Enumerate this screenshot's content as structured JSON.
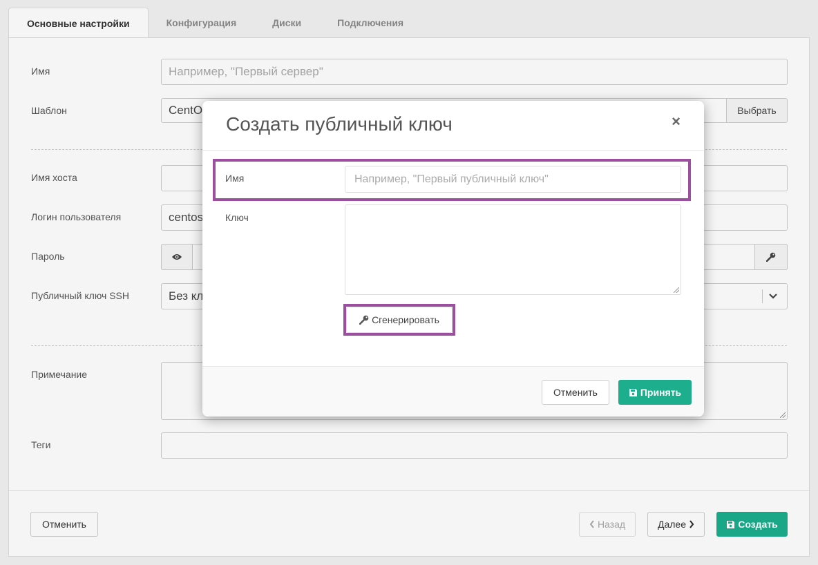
{
  "tabs": [
    {
      "label": "Основные настройки",
      "active": true
    },
    {
      "label": "Конфигурация",
      "active": false
    },
    {
      "label": "Диски",
      "active": false
    },
    {
      "label": "Подключения",
      "active": false
    }
  ],
  "form": {
    "name_label": "Имя",
    "name_placeholder": "Например, \"Первый сервер\"",
    "template_label": "Шаблон",
    "template_value": "CentOS",
    "template_button": "Выбрать",
    "hostname_label": "Имя хоста",
    "login_label": "Логин пользователя",
    "login_value": "centos",
    "password_label": "Пароль",
    "ssh_key_label": "Публичный ключ SSH",
    "ssh_key_value": "Без кл",
    "note_label": "Примечание",
    "tags_label": "Теги"
  },
  "footer": {
    "cancel": "Отменить",
    "back": "Назад",
    "next": "Далее",
    "create": "Создать"
  },
  "modal": {
    "title": "Создать публичный ключ",
    "close": "×",
    "name_label": "Имя",
    "name_placeholder": "Например, \"Первый публичный ключ\"",
    "key_label": "Ключ",
    "generate_button": "Сгенерировать",
    "cancel_button": "Отменить",
    "accept_button": "Принять"
  },
  "colors": {
    "primary": "#1cae8d",
    "highlight": "#9b4f9e"
  }
}
